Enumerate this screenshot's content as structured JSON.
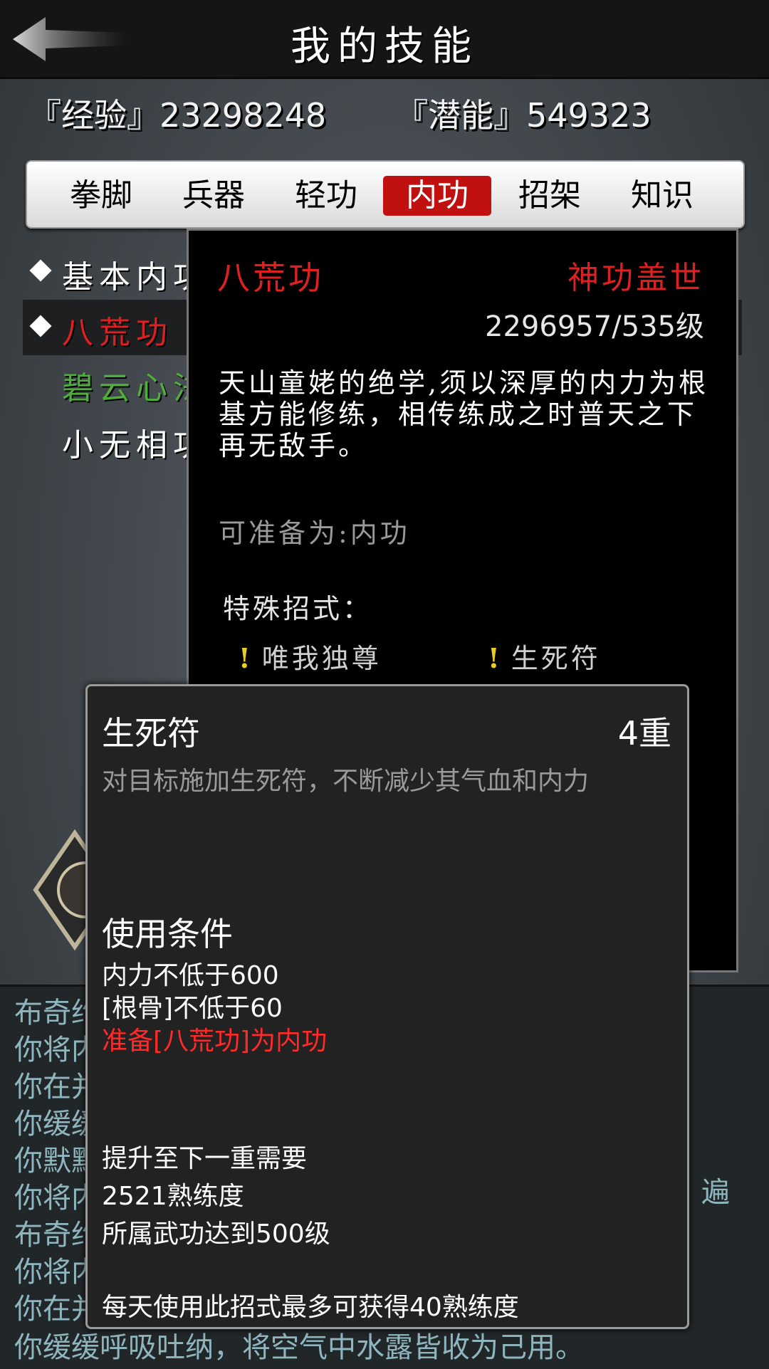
{
  "header": {
    "title": "我的技能",
    "back_icon": "back-arrow-icon"
  },
  "stats": {
    "experience": "『经验』23298248",
    "potential": "『潜能』549323"
  },
  "tabs": [
    {
      "label": "拳脚",
      "active": false
    },
    {
      "label": "兵器",
      "active": false
    },
    {
      "label": "轻功",
      "active": false
    },
    {
      "label": "内功",
      "active": true
    },
    {
      "label": "招架",
      "active": false
    },
    {
      "label": "知识",
      "active": false
    }
  ],
  "skill_list": [
    {
      "name": "基本内功",
      "color": "#ffffff",
      "selected": false
    },
    {
      "name": "八荒功",
      "color": "#e02020",
      "selected": true
    },
    {
      "name": "碧云心法",
      "color": "#4fae3c",
      "selected": false
    },
    {
      "name": "小无相功",
      "color": "#ffffff",
      "selected": false
    }
  ],
  "detail": {
    "name": "八荒功",
    "rank": "神功盖世",
    "progress": "2296957/535级",
    "description": "天山童姥的绝学,须以深厚的内力为根基方能修练，相传练成之时普天之下再无敌手。",
    "prepare_as": "可准备为:内功",
    "special_title": "特殊招式：",
    "moves": [
      "唯我独尊",
      "生死符"
    ],
    "move_mark": "!"
  },
  "move_popup": {
    "title": "生死符",
    "level": "4重",
    "description": "对目标施加生死符，不断减少其气血和内力",
    "conditions_title": "使用条件",
    "conditions": [
      {
        "text": "内力不低于600",
        "met": true
      },
      {
        "text": "[根骨]不低于60",
        "met": true
      },
      {
        "text": "准备[八荒功]为内功",
        "met": false
      }
    ],
    "upgrade_title": "提升至下一重需要",
    "upgrade_lines": [
      "2521熟练度",
      "所属武功达到500级"
    ],
    "daily_note": "每天使用此招式最多可获得40熟练度"
  },
  "log": {
    "lines": [
      "布奇约",
      "你将内",
      "你在并",
      "你缓缓",
      "你默默",
      "你将内",
      "布奇约",
      "你将内",
      "你在并",
      "你缓缓呼吸吐纳，将空气中水露皆收为己用。"
    ],
    "side_text": "遍"
  },
  "colors": {
    "accent_red": "#c0100f",
    "learned_green": "#4fae3c",
    "log_text": "#8fb6bf",
    "move_mark": "#e8d020"
  }
}
